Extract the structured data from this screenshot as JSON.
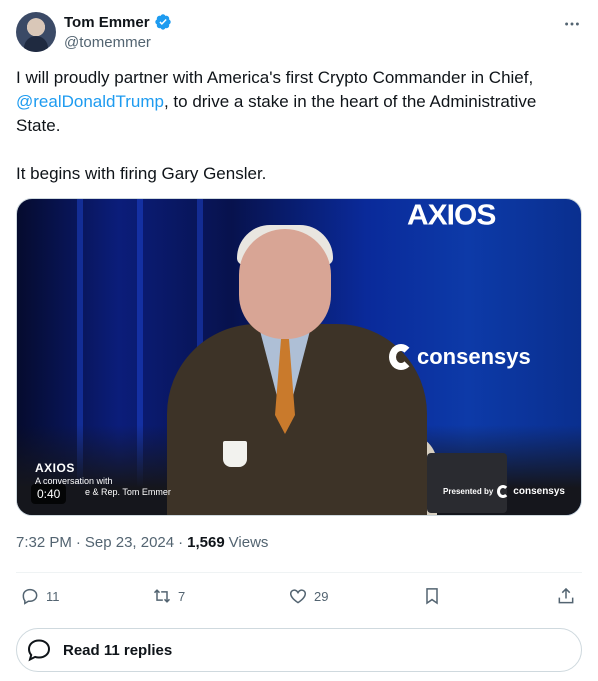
{
  "author": {
    "name": "Tom Emmer",
    "handle": "@tomemmer",
    "verified": true
  },
  "tweet": {
    "line1_prefix": "I will proudly partner with America's first Crypto Commander in Chief,",
    "mention": "@realDonaldTrump",
    "line1_suffix": ", to drive a stake in the heart of the Administrative State.",
    "line2": "It begins with firing Gary Gensler."
  },
  "media": {
    "brand_top": "AXIOS",
    "sponsor_logo": "consensys",
    "overlay_brand": "AXIOS",
    "overlay_sub1": "A conversation with",
    "overlay_sub2": "e & Rep. Tom Emmer",
    "duration": "0:40",
    "presented_by": "Presented by",
    "presented_name": "consensys"
  },
  "meta": {
    "time": "7:32 PM",
    "separator1": "·",
    "date": "Sep 23, 2024",
    "separator2": "·",
    "views_count": "1,569",
    "views_label": "Views"
  },
  "actions": {
    "replies": "11",
    "reposts": "7",
    "likes": "29"
  },
  "read_replies": {
    "label": "Read 11 replies"
  },
  "colors": {
    "accent": "#1d9bf0",
    "text": "#0f1419",
    "secondary": "#536471",
    "border": "#cfd9de"
  },
  "icons": [
    "verified-badge-icon",
    "more-icon",
    "reply-icon",
    "repost-icon",
    "like-icon",
    "bookmark-icon",
    "share-icon",
    "speech-bubble-icon"
  ]
}
